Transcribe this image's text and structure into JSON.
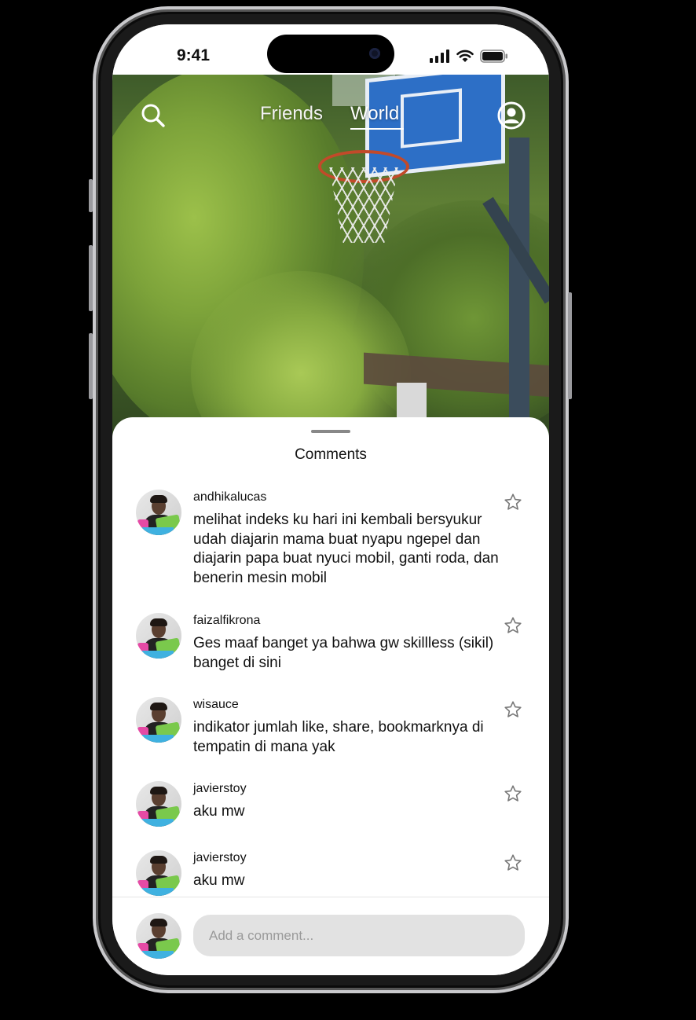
{
  "status_bar": {
    "time": "9:41"
  },
  "top_nav": {
    "tabs": [
      {
        "label": "Friends",
        "active": false
      },
      {
        "label": "World",
        "active": true
      }
    ],
    "search_icon": "search-icon",
    "profile_icon": "user-circle-icon"
  },
  "comments_sheet": {
    "title": "Comments",
    "comments": [
      {
        "username": "andhikalucas",
        "text": "melihat indeks ku hari ini kembali bersyukur udah diajarin mama buat nyapu ngepel dan diajarin papa buat nyuci mobil, ganti roda, dan benerin mesin mobil"
      },
      {
        "username": "faizalfikrona",
        "text": "Ges maaf banget ya bahwa gw skillless (sikil) banget di sini"
      },
      {
        "username": "wisauce",
        "text": "indikator jumlah like, share, bookmarknya di tempatin di mana yak"
      },
      {
        "username": "javierstoy",
        "text": "aku mw"
      },
      {
        "username": "javierstoy",
        "text": "aku mw"
      }
    ],
    "composer": {
      "placeholder": "Add a comment..."
    }
  },
  "colors": {
    "sheet_bg": "#ffffff",
    "input_bg": "#e2e2e2",
    "backboard": "#2d6fc6"
  }
}
